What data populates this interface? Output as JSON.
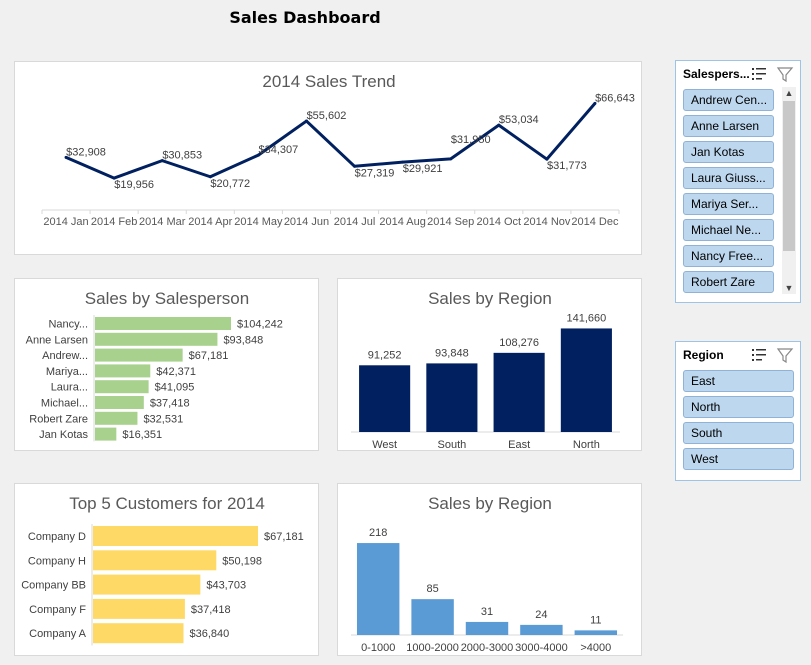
{
  "dashboard_title": "Sales Dashboard",
  "colors": {
    "navy": "#002060",
    "green": "#a9d18e",
    "yellow": "#ffd966",
    "blue": "#5b9bd5",
    "slicer_item": "#bdd7ee",
    "slicer_border": "#9dc3e6"
  },
  "charts": [
    {
      "type": "line",
      "title": "2014 Sales Trend",
      "categories": [
        "2014 Jan",
        "2014 Feb",
        "2014 Mar",
        "2014 Apr",
        "2014 May",
        "2014 Jun",
        "2014 Jul",
        "2014 Aug",
        "2014 Sep",
        "2014 Oct",
        "2014 Nov",
        "2014 Dec"
      ],
      "values": [
        32908,
        19956,
        30853,
        20772,
        34307,
        55602,
        27319,
        29921,
        31950,
        53034,
        31773,
        66643
      ],
      "labels": [
        "$32,908",
        "$19,956",
        "$30,853",
        "$20,772",
        "$34,307",
        "$55,602",
        "$27,319",
        "$29,921",
        "$31,950",
        "$53,034",
        "$31,773",
        "$66,643"
      ],
      "ylim": [
        0,
        80000
      ]
    },
    {
      "type": "bar",
      "orientation": "horizontal",
      "title": "Sales by Salesperson",
      "categories": [
        "Nancy...",
        "Anne Larsen",
        "Andrew...",
        "Mariya...",
        "Laura...",
        "Michael...",
        "Robert Zare",
        "Jan Kotas"
      ],
      "values": [
        104242,
        93848,
        67181,
        42371,
        41095,
        37418,
        32531,
        16351
      ],
      "labels": [
        "$104,242",
        "$93,848",
        "$67,181",
        "$42,371",
        "$41,095",
        "$37,418",
        "$32,531",
        "$16,351"
      ],
      "xlim": [
        0,
        104242
      ]
    },
    {
      "type": "bar",
      "title": "Sales by Region",
      "categories": [
        "West",
        "South",
        "East",
        "North"
      ],
      "values": [
        91252,
        93848,
        108276,
        141660
      ],
      "labels": [
        "91,252",
        "93,848",
        "108,276",
        "141,660"
      ],
      "ylim": [
        0,
        145000
      ]
    },
    {
      "type": "bar",
      "orientation": "horizontal",
      "title": "Top 5 Customers for 2014",
      "categories": [
        "Company D",
        "Company H",
        "Company BB",
        "Company F",
        "Company A"
      ],
      "values": [
        67181,
        50198,
        43703,
        37418,
        36840
      ],
      "labels": [
        "$67,181",
        "$50,198",
        "$43,703",
        "$37,418",
        "$36,840"
      ],
      "xlim": [
        0,
        67181
      ]
    },
    {
      "type": "bar",
      "title": "Sales by Region",
      "categories": [
        "0-1000",
        "1000-2000",
        "2000-3000",
        "3000-4000",
        ">4000"
      ],
      "values": [
        218,
        85,
        31,
        24,
        11
      ],
      "labels": [
        "218",
        "85",
        "31",
        "24",
        "11"
      ],
      "ylim": [
        0,
        230
      ]
    }
  ],
  "slicers": {
    "salesperson": {
      "title": "Salespers...",
      "items": [
        "Andrew Cen...",
        "Anne Larsen",
        "Jan Kotas",
        "Laura Giuss...",
        "Mariya Ser...",
        "Michael Ne...",
        "Nancy Free...",
        "Robert Zare"
      ]
    },
    "region": {
      "title": "Region",
      "items": [
        "East",
        "North",
        "South",
        "West"
      ]
    }
  }
}
